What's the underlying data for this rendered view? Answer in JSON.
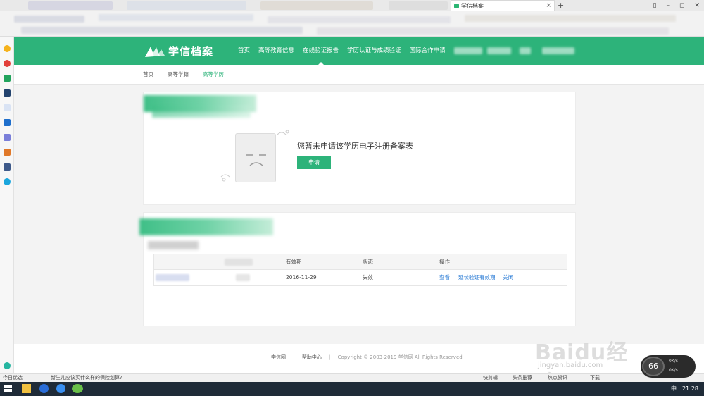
{
  "browser": {
    "tab_title": "学信档案",
    "tab_close": "×",
    "new_tab": "+",
    "window_controls": [
      "▯",
      "–",
      "◻",
      "✕"
    ]
  },
  "site": {
    "logo_text": "学信档案",
    "nav": [
      {
        "label": "首页",
        "active": false
      },
      {
        "label": "高等教育信息",
        "active": false
      },
      {
        "label": "在线验证报告",
        "active": true
      },
      {
        "label": "学历认证与成绩验证",
        "active": false
      },
      {
        "label": "国际合作申请",
        "active": false
      }
    ]
  },
  "subnav": {
    "items": [
      "首页",
      "高等学籍",
      "高等学历"
    ],
    "current": "高等学历"
  },
  "card1": {
    "empty_message": "您暂未申请该学历电子注册备案表",
    "apply_button": "申请"
  },
  "table": {
    "headers": [
      "有效期",
      "状态",
      "操作"
    ],
    "rows": [
      {
        "expiry": "2016-11-29",
        "status": "失效",
        "actions": [
          "查看",
          "延长验证有效期",
          "关闭"
        ]
      }
    ]
  },
  "footer": {
    "links": [
      "学信网",
      "帮助中心"
    ],
    "separator": "|",
    "copyright": "Copyright © 2003-2019 学信网 All Rights Reserved"
  },
  "statusbar": {
    "left_label": "今日优选",
    "news": "新生儿应该买什么样的保险划算?",
    "items": [
      "快剪辑",
      "头条推荐",
      "热点资讯",
      "下载"
    ]
  },
  "watermark": {
    "text": "Baidu经验",
    "sub": "jingyan.baidu.com"
  },
  "net_widget": {
    "percent": "66",
    "up": "0K/s",
    "down": "0K/s"
  },
  "taskbar": {
    "ime": "中",
    "time": "21:28"
  },
  "colors": {
    "brand_green": "#2db37a",
    "link_blue": "#2a7bd5"
  }
}
